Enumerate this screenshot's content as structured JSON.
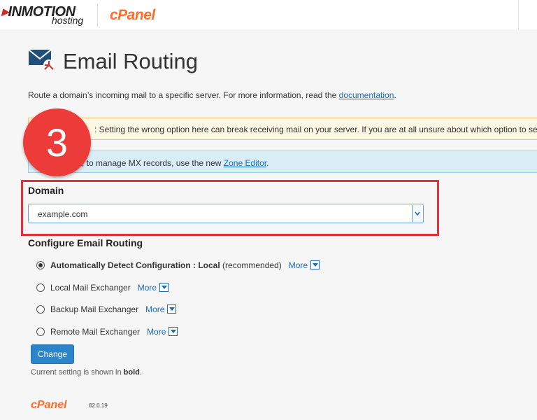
{
  "header": {
    "brand_primary": "INMOTION",
    "brand_secondary": "hosting",
    "cpanel_logo": "cPanel"
  },
  "page": {
    "title": "Email Routing",
    "icon": "email-routing-icon",
    "description_prefix": "Route a domain’s incoming mail to a specific server. For more information, read the ",
    "description_link": "documentation",
    "description_suffix": "."
  },
  "alerts": {
    "warning_text": ": Setting the wrong option here can break receiving mail on your server. If you are at all unsure about which option to select, c",
    "info_text_prefix": ", to manage MX records, use the new ",
    "info_link": "Zone Editor",
    "info_text_suffix": "."
  },
  "step_badge": "3",
  "domain": {
    "label": "Domain",
    "selected": "example.com"
  },
  "routing": {
    "title": "Configure Email Routing",
    "more_label": "More",
    "options": [
      {
        "label_bold": "Automatically Detect Configuration : Local",
        "label_rest": " (recommended)",
        "checked": true
      },
      {
        "label_bold": "",
        "label_rest": "Local Mail Exchanger",
        "checked": false
      },
      {
        "label_bold": "",
        "label_rest": "Backup Mail Exchanger",
        "checked": false
      },
      {
        "label_bold": "",
        "label_rest": "Remote Mail Exchanger",
        "checked": false
      }
    ]
  },
  "actions": {
    "change_label": "Change",
    "note_prefix": "Current setting is shown in ",
    "note_bold": "bold",
    "note_suffix": "."
  },
  "footer": {
    "logo": "cPanel",
    "version": "82.0.19"
  },
  "colors": {
    "accent": "#2c85c8",
    "cpanel_orange": "#ff6c2c",
    "highlight_red": "#e2313a"
  }
}
